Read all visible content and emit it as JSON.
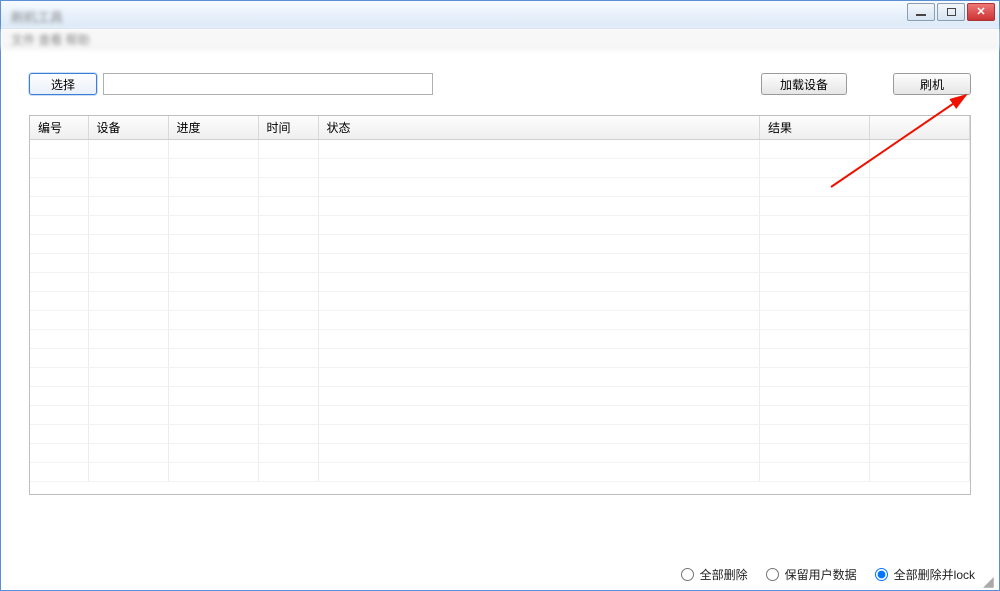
{
  "titlebar": {
    "title_blurred": "刷机工具"
  },
  "menubar_blurred": "文件   查看   帮助",
  "toolbar": {
    "select_label": "选择",
    "path_value": "",
    "load_label": "加载设备",
    "flash_label": "刷机"
  },
  "table": {
    "columns": [
      "编号",
      "设备",
      "进度",
      "时间",
      "状态",
      "结果",
      ""
    ]
  },
  "footer": {
    "radios": [
      {
        "label": "全部删除",
        "checked": false
      },
      {
        "label": "保留用户数据",
        "checked": false
      },
      {
        "label": "全部删除并lock",
        "checked": true
      }
    ]
  }
}
